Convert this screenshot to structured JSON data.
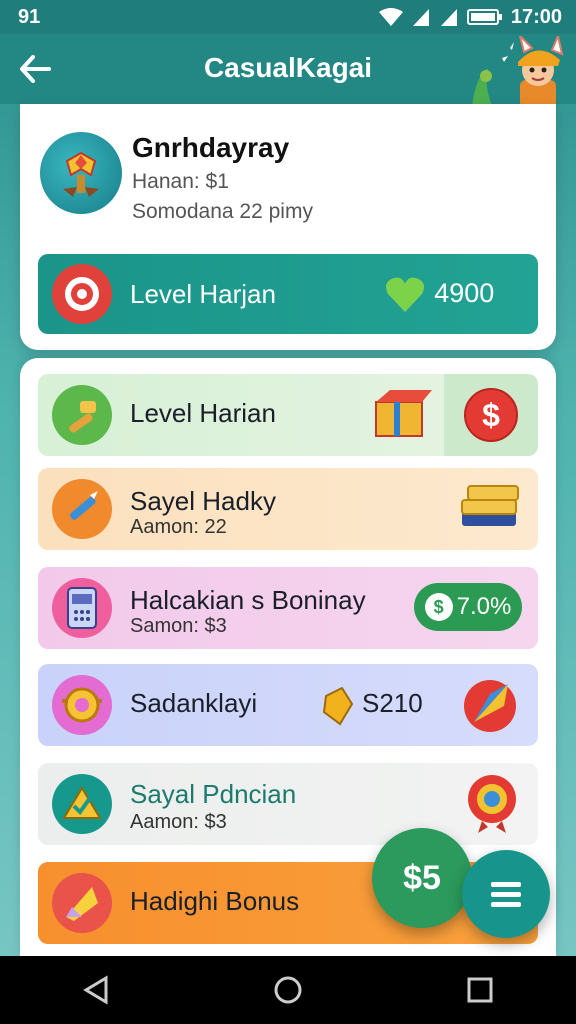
{
  "status_bar": {
    "left": "91",
    "time": "17:00"
  },
  "app_bar": {
    "title": "CasualKagai"
  },
  "profile": {
    "name": "Gnrhdayray",
    "line1": "Hanan: $1",
    "line2": "Somodana 22 pimy",
    "level_banner": {
      "label": "Level Harjan",
      "amount": " 4900"
    }
  },
  "rows": [
    {
      "title": "Level Harian",
      "sub": ""
    },
    {
      "title": "Sayel Hadky",
      "sub": "Aamon: 22"
    },
    {
      "title": "Halcakian s Boninay",
      "sub": "Samon: $3",
      "pill": "7.0%"
    },
    {
      "title": "Sadanklayi",
      "amount": "S210"
    },
    {
      "title": "Sayal Pdncian",
      "sub": "Aamon: $3"
    },
    {
      "title": "Hadighi Bonus"
    }
  ],
  "fab_cash": "$5",
  "colors": {
    "primary": "#238784",
    "accent_green": "#2b9a5c",
    "orange": "#f78f2d"
  }
}
